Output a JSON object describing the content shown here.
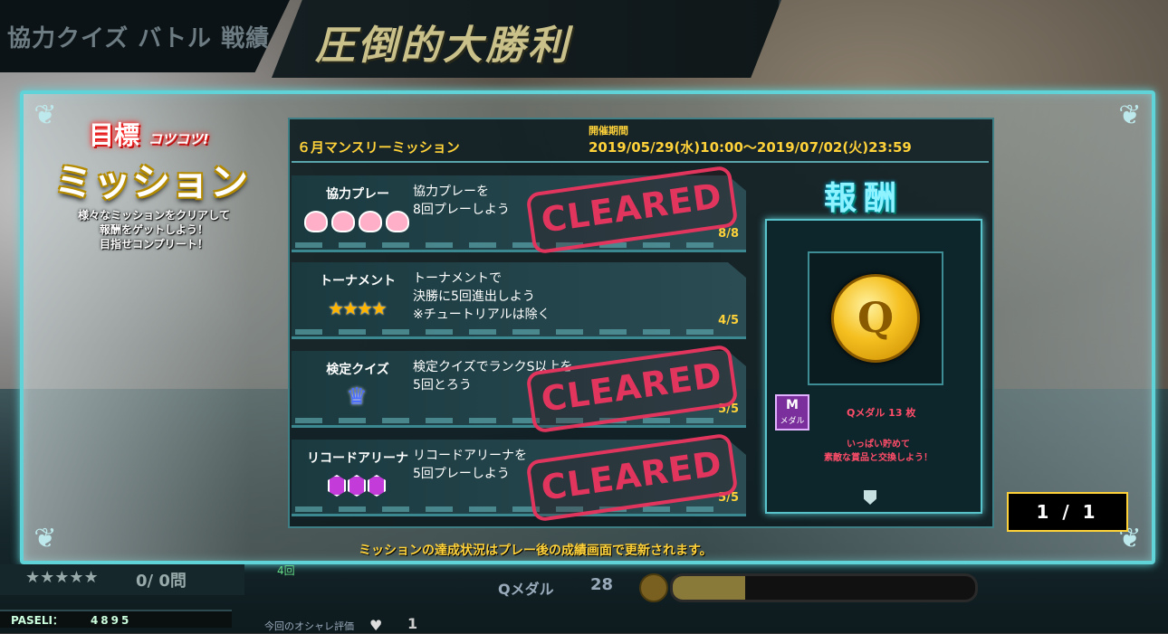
{
  "header": {
    "left_title": "協力クイズ バトル 戦績",
    "result_title": "圧倒的大勝利"
  },
  "goal": {
    "tag_main": "目標",
    "tag_sub": "コツコツ!",
    "title": "ミッション",
    "desc_lines": [
      "様々なミッションをクリアして",
      "報酬をゲットしよう！",
      "目指せコンプリート！"
    ]
  },
  "mission_panel": {
    "title": "６月マンスリーミッション",
    "period_label": "開催期間",
    "period": "2019/05/29(水)10:00〜2019/07/02(火)23:59"
  },
  "missions": [
    {
      "name": "協力プレー",
      "desc": [
        "協力プレーを",
        "8回プレーしよう"
      ],
      "progress": "8/8",
      "cleared": true,
      "stamp": "CLEARED",
      "icon": "face-icons"
    },
    {
      "name": "トーナメント",
      "desc": [
        "トーナメントで",
        "決勝に5回進出しよう",
        "※チュートリアルは除く"
      ],
      "progress": "4/5",
      "cleared": false,
      "icon": "stars-icon",
      "stars": "★★★★"
    },
    {
      "name": "検定クイズ",
      "desc": [
        "検定クイズでランクS以上を",
        "5回とろう"
      ],
      "progress": "5/5",
      "cleared": true,
      "stamp": "CLEARED",
      "icon": "crown-icon",
      "crown": "♛"
    },
    {
      "name": "リコードアリーナ",
      "desc": [
        "リコードアリーナを",
        "5回プレーしよう"
      ],
      "progress": "5/5",
      "cleared": true,
      "stamp": "CLEARED",
      "icon": "gems-icon"
    }
  ],
  "reward": {
    "title": "報酬",
    "coin_letter": "Q",
    "item_badge": "M",
    "item_badge_label": "メダル",
    "item_name": "Qメダル 13 枚",
    "note_lines": [
      "いっぱい貯めて",
      "素敵な賞品と交換しよう！"
    ]
  },
  "pager": "1 / 1",
  "notice": "ミッションの達成状況はプレー後の成績画面で更新されます。",
  "hud": {
    "stars": "★★★★★",
    "question_count": "0/ 0問",
    "round": "4回",
    "medal_label": "Qメダル",
    "medal_count": "28",
    "medal_progress": 0.24,
    "paseli_label": "PASELI：",
    "paseli_value": "4895",
    "oshare_label": "今回のオシャレ評価",
    "oshare_value": "1"
  },
  "colors": {
    "accent_cyan": "#5fd3d8",
    "accent_yellow": "#ffd23a",
    "stamp_pink": "#e2355e"
  }
}
